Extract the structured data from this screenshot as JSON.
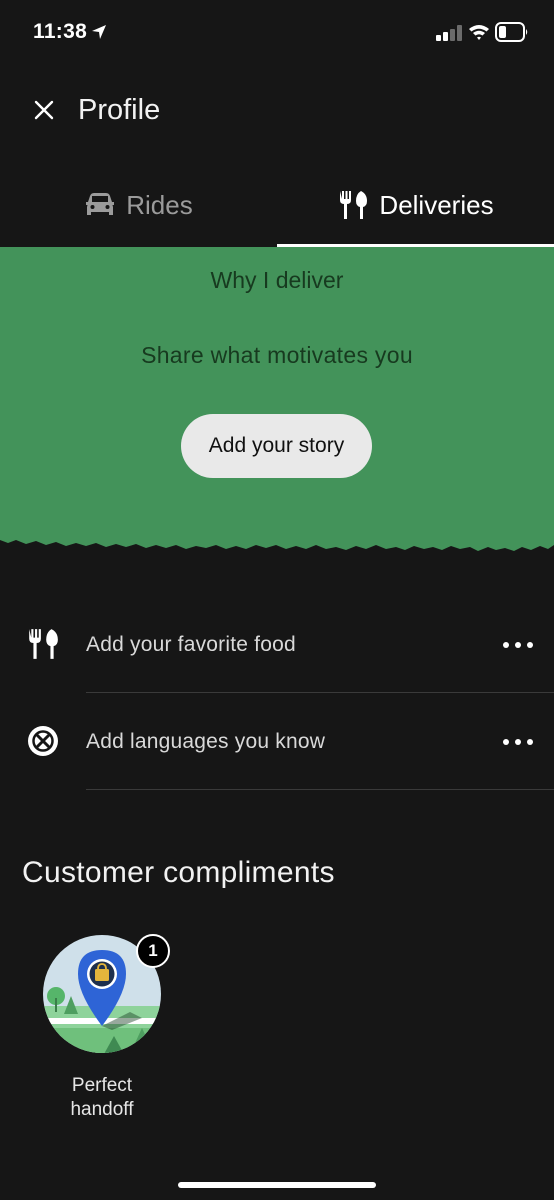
{
  "status_bar": {
    "time": "11:38",
    "location_icon": "location-arrow-icon",
    "signal_icon": "cellular-signal-icon",
    "wifi_icon": "wifi-icon",
    "battery_icon": "battery-icon"
  },
  "header": {
    "close_icon": "close-icon",
    "title": "Profile"
  },
  "tabs": [
    {
      "label": "Rides",
      "icon": "car-icon",
      "selected": false
    },
    {
      "label": "Deliveries",
      "icon": "fork-knife-icon",
      "selected": true
    }
  ],
  "story": {
    "heading": "Why I deliver",
    "subtitle": "Share what motivates you",
    "button_label": "Add your story",
    "background_color": "#43935a"
  },
  "profile_items": [
    {
      "label": "Add your favorite food",
      "icon": "fork-knife-icon",
      "more_icon": "more-dots-icon"
    },
    {
      "label": "Add languages you know",
      "icon": "language-globe-icon",
      "more_icon": "more-dots-icon"
    }
  ],
  "compliments": {
    "title": "Customer compliments",
    "items": [
      {
        "label": "Perfect handoff",
        "count": "1",
        "icon": "map-pin-bag-icon"
      }
    ]
  },
  "colors": {
    "background": "#161616",
    "accent_green": "#43935a",
    "text_dark_green": "#173a1f"
  }
}
